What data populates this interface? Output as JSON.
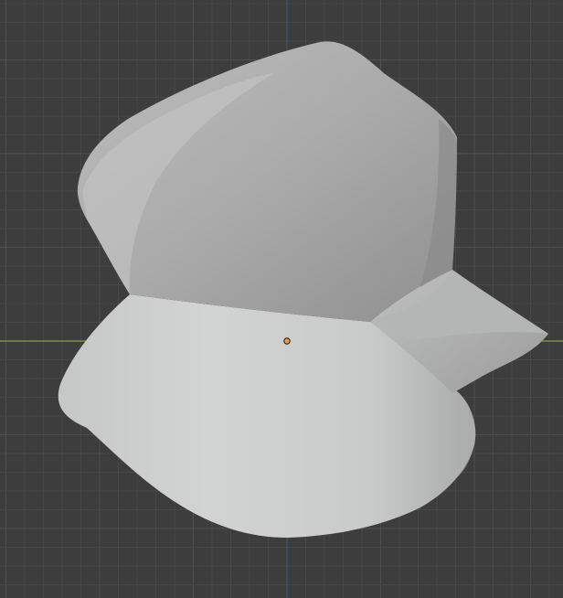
{
  "viewport": {
    "background_color": "#3d3d3d",
    "grid_minor_color": "#474747",
    "grid_major_color": "#505050",
    "x_axis_color": "#7fa83a",
    "y_axis_color": "#3f5a78",
    "origin_color": "#f29d2e",
    "mesh_light_color": "#cfd0d0",
    "mesh_mid_color": "#a9a9a9",
    "mesh_dark_color": "#7a7a7a"
  },
  "scene": {
    "object": {
      "name": "",
      "shading": "solid",
      "origin_marker_icon": "origin-dot-icon"
    }
  }
}
